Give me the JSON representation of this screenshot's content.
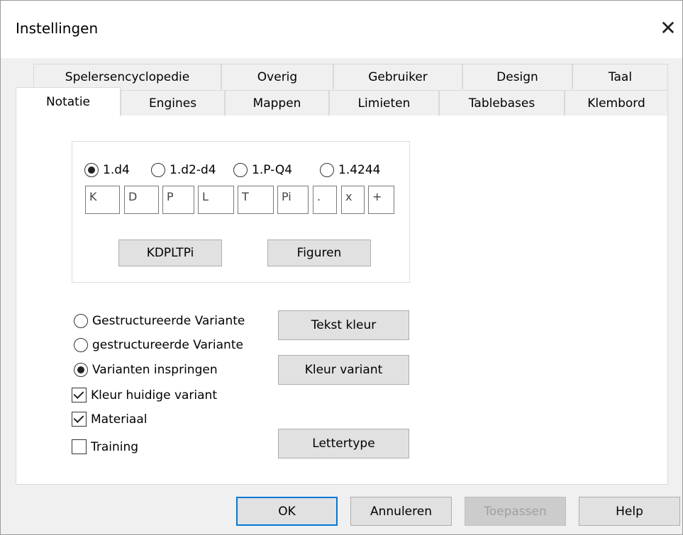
{
  "dialog": {
    "title": "Instellingen",
    "close_glyph": "✕"
  },
  "tabs": {
    "row1": [
      "Spelersencyclopedie",
      "Overig",
      "Gebruiker",
      "Design",
      "Taal"
    ],
    "row2": [
      "Notatie",
      "Engines",
      "Mappen",
      "Limieten",
      "Tablebases",
      "Klembord"
    ],
    "active": "Notatie"
  },
  "notation": {
    "formats": [
      {
        "label": "1.d4",
        "selected": true
      },
      {
        "label": "1.d2-d4",
        "selected": false
      },
      {
        "label": "1.P-Q4",
        "selected": false
      },
      {
        "label": "1.4244",
        "selected": false
      }
    ],
    "pieces": [
      "K",
      "D",
      "P",
      "L",
      "T",
      "Pi",
      ".",
      "x",
      "+"
    ],
    "buttons": {
      "reset": "KDPLTPi",
      "figures": "Figuren"
    }
  },
  "variants": {
    "options": [
      {
        "label": "Gestructureerde Variante",
        "selected": false
      },
      {
        "label": "gestructureerde Variante",
        "selected": false
      },
      {
        "label": "Varianten inspringen",
        "selected": true
      }
    ],
    "checkboxes": [
      {
        "label": "Kleur huidige variant",
        "checked": true
      },
      {
        "label": "Materiaal",
        "checked": true
      },
      {
        "label": "Training",
        "checked": false
      }
    ],
    "buttons": {
      "text_color": "Tekst kleur",
      "variant_color": "Kleur variant",
      "font": "Lettertype"
    }
  },
  "footer": {
    "ok": "OK",
    "cancel": "Annuleren",
    "apply": "Toepassen",
    "help": "Help"
  }
}
